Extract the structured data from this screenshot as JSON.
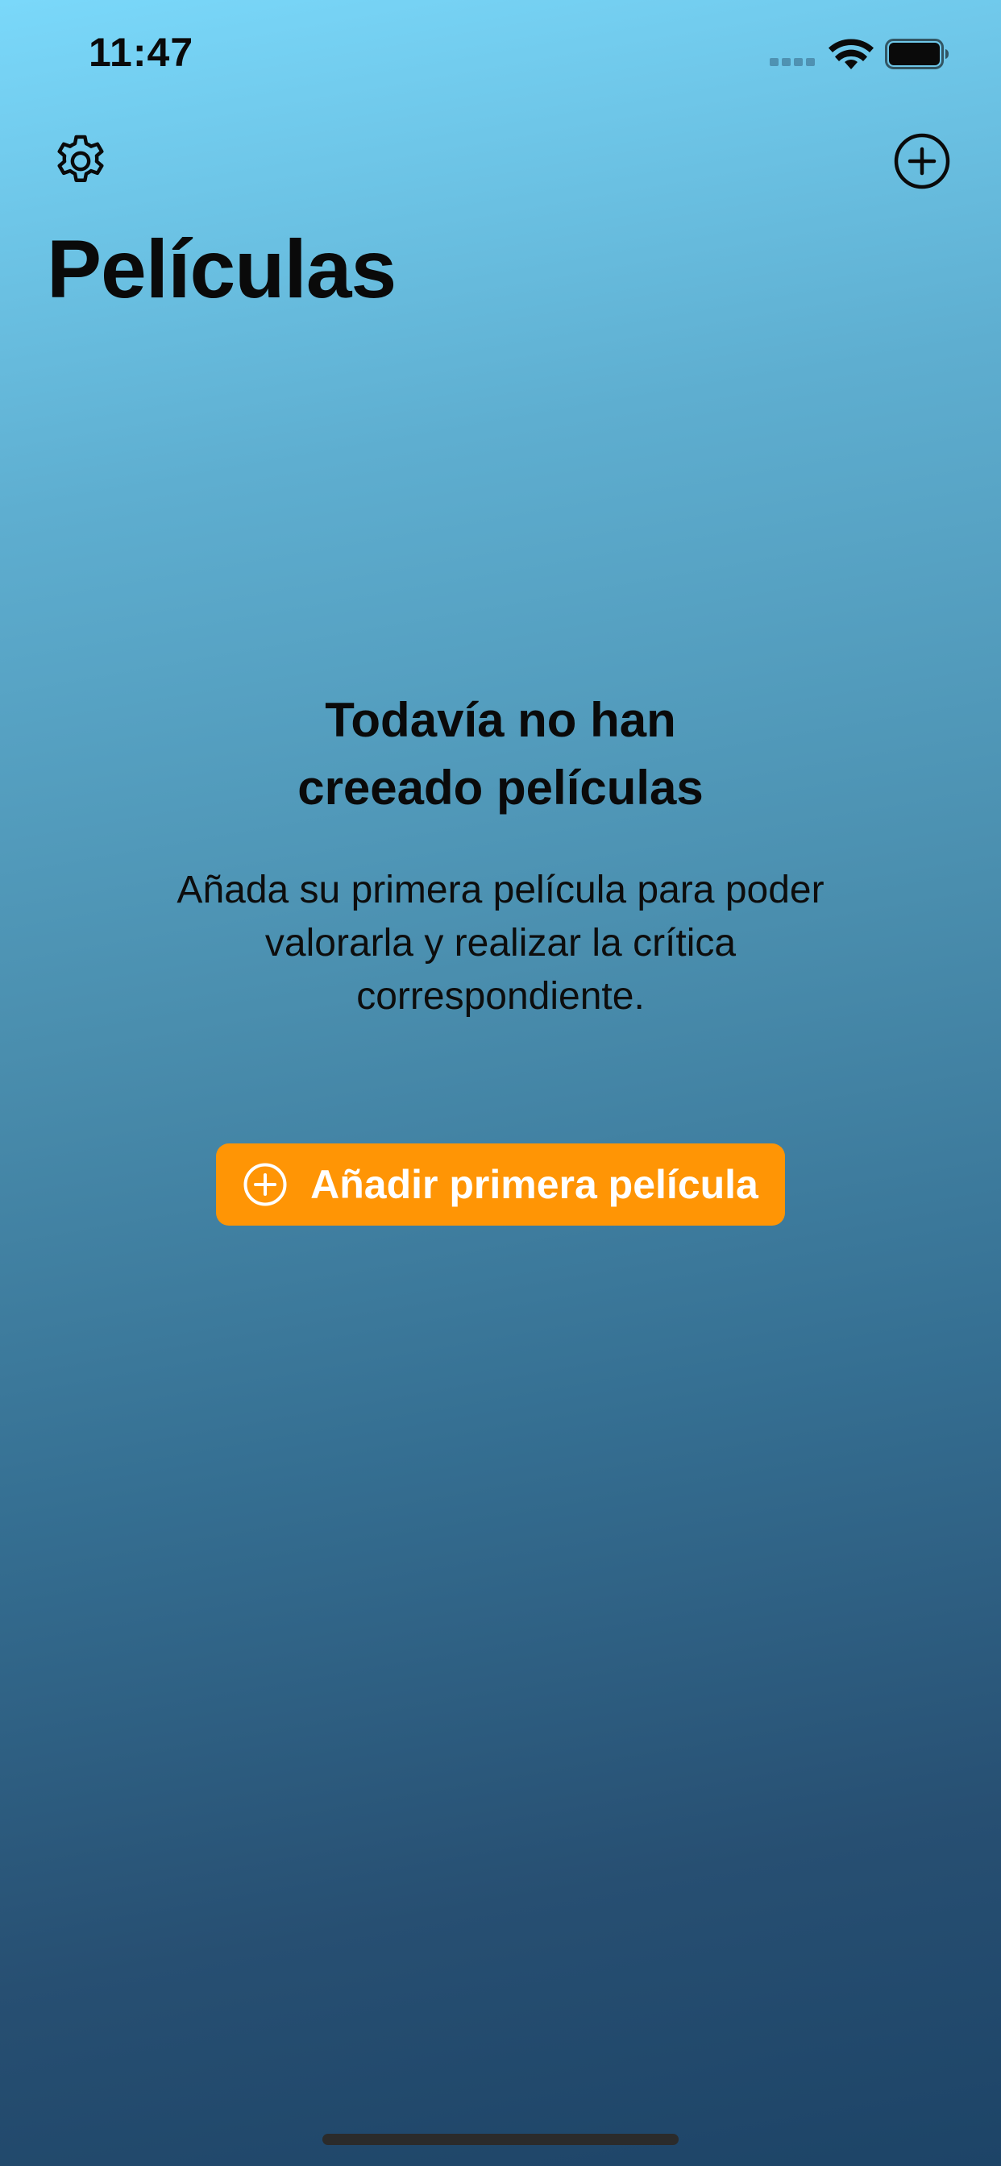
{
  "status_bar": {
    "time": "11:47",
    "icons": [
      "cellular-signal-icon",
      "wifi-icon",
      "battery-icon"
    ]
  },
  "nav": {
    "left_icon": "gear-icon",
    "right_icon": "plus-circle-icon",
    "title": "Películas"
  },
  "empty_state": {
    "title_line1": "Todavía no han",
    "title_line2": "creeado películas",
    "message_line1": "Añada su primera película para poder",
    "message_line2": "valorarla y realizar la crítica",
    "message_line3": "correspondiente."
  },
  "primary_button": {
    "icon": "plus-circle-icon",
    "label": "Añadir primera película"
  },
  "colors": {
    "accent": "#ff9505",
    "background_top": "#7ad8fa",
    "background_bottom": "#1d4467"
  }
}
